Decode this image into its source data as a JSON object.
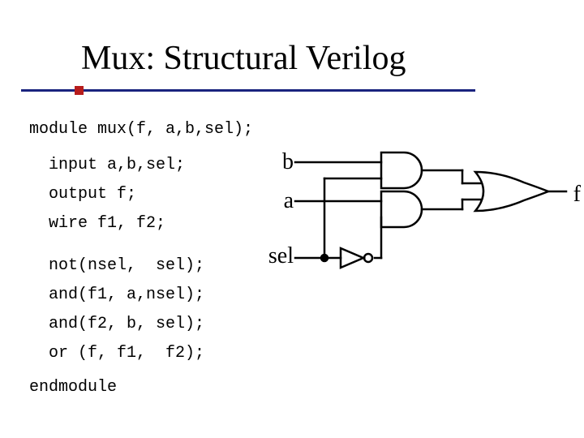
{
  "title": "Mux: Structural Verilog",
  "code": {
    "l1": "module mux(f, a,b,sel);",
    "l2": "input a,b,sel;",
    "l3": "output f;",
    "l4": "wire f1, f2;",
    "l5": "not(nsel,  sel);",
    "l6": "and(f1, a,nsel);",
    "l7": "and(f2, b, sel);",
    "l8": "or (f, f1,  f2);",
    "l9": "endmodule"
  },
  "signals": {
    "b": "b",
    "a": "a",
    "sel": "sel",
    "f": "f"
  }
}
